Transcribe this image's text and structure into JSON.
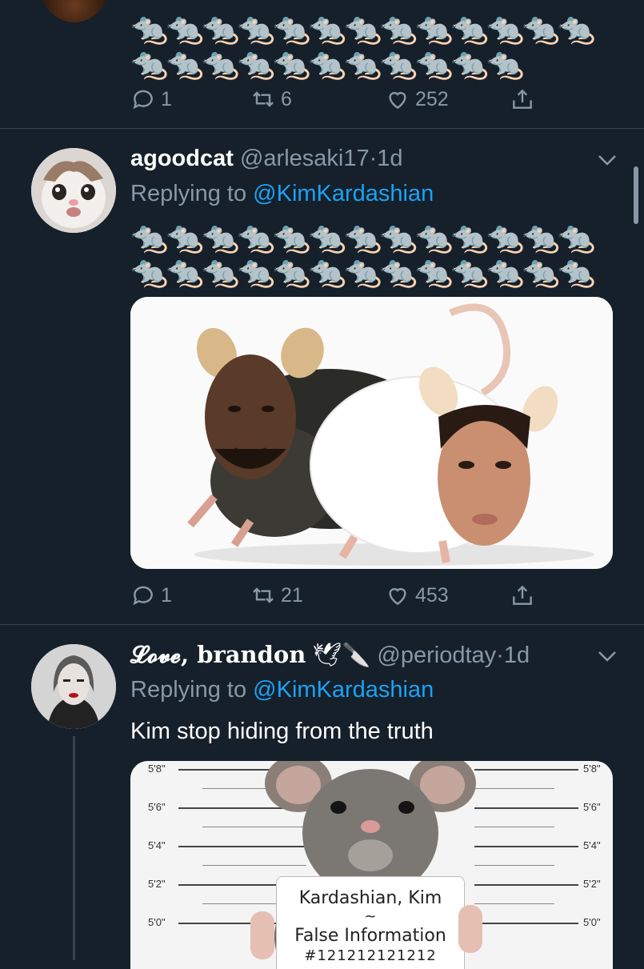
{
  "tweet1": {
    "emoji_rows": [
      [
        "🐀",
        "🐀",
        "🐀",
        "🐀",
        "🐀",
        "🐀",
        "🐀",
        "🐀",
        "🐀",
        "🐀",
        "🐀",
        "🐀",
        "🐀"
      ],
      [
        "🐀",
        "🐀",
        "🐀",
        "🐀",
        "🐀",
        "🐀",
        "🐀",
        "🐀",
        "🐀",
        "🐀",
        "🐀"
      ]
    ],
    "replies": "1",
    "retweets": "6",
    "likes": "252"
  },
  "tweet2": {
    "display_name": "agoodcat",
    "handle": "@arlesaki17",
    "dot": "·",
    "time": "1d",
    "replying_prefix": "Replying to",
    "replying_to": "@KimKardashian",
    "emoji_rows": [
      [
        "🐀",
        "🐀",
        "🐀",
        "🐀",
        "🐀",
        "🐀",
        "🐀",
        "🐀",
        "🐀",
        "🐀",
        "🐀",
        "🐀",
        "🐀"
      ],
      [
        "🐀",
        "🐀",
        "🐀",
        "🐀",
        "🐀",
        "🐀",
        "🐀",
        "🐀",
        "🐀",
        "🐀",
        "🐀",
        "🐀",
        "🐀"
      ]
    ],
    "replies": "1",
    "retweets": "21",
    "likes": "453"
  },
  "tweet3": {
    "display_name": "𝓛𝓸𝓿𝓮, brandon",
    "name_emojis": "🕊🔪",
    "handle": "@periodtay",
    "dot": "·",
    "time": "1d",
    "replying_prefix": "Replying to",
    "replying_to": "@KimKardashian",
    "text": "Kim stop hiding from the truth",
    "mugshot": {
      "heights": [
        "5'8\"",
        "5'6\"",
        "5'4\"",
        "5'2\"",
        "5'0\""
      ],
      "sign_name": "Kardashian, Kim",
      "sign_tilde": "~",
      "sign_subtitle": "False Information",
      "sign_number": "#121212121212"
    }
  },
  "colors": {
    "background": "#15202b",
    "divider": "#38444d",
    "secondary_text": "#8899a6",
    "link": "#1da1f2"
  },
  "icons": [
    "reply-icon",
    "retweet-icon",
    "like-icon",
    "share-icon",
    "chevron-down-icon"
  ]
}
